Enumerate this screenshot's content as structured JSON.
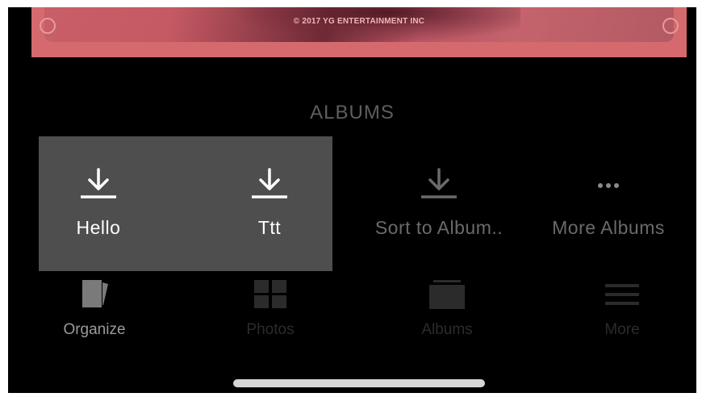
{
  "banner": {
    "copyright": "© 2017 YG ENTERTAINMENT INC"
  },
  "albums_section": {
    "title": "ALBUMS"
  },
  "actions": [
    {
      "label": "Hello",
      "icon": "download-icon"
    },
    {
      "label": "Ttt",
      "icon": "download-icon"
    },
    {
      "label": "Sort to Album..",
      "icon": "download-icon"
    },
    {
      "label": "More Albums",
      "icon": "more-dots-icon"
    }
  ],
  "tabbar": {
    "tabs": [
      {
        "label": "Organize",
        "icon": "organize-icon",
        "selected": true
      },
      {
        "label": "Photos",
        "icon": "photos-grid-icon",
        "selected": false
      },
      {
        "label": "Albums",
        "icon": "albums-icon",
        "selected": false
      },
      {
        "label": "More",
        "icon": "menu-lines-icon",
        "selected": false
      }
    ]
  },
  "colors": {
    "background": "#000000",
    "panel": "#4e4e4e",
    "banner": "#d46a6e",
    "active_text": "#ffffff",
    "dim_text": "#6a6a6a"
  }
}
